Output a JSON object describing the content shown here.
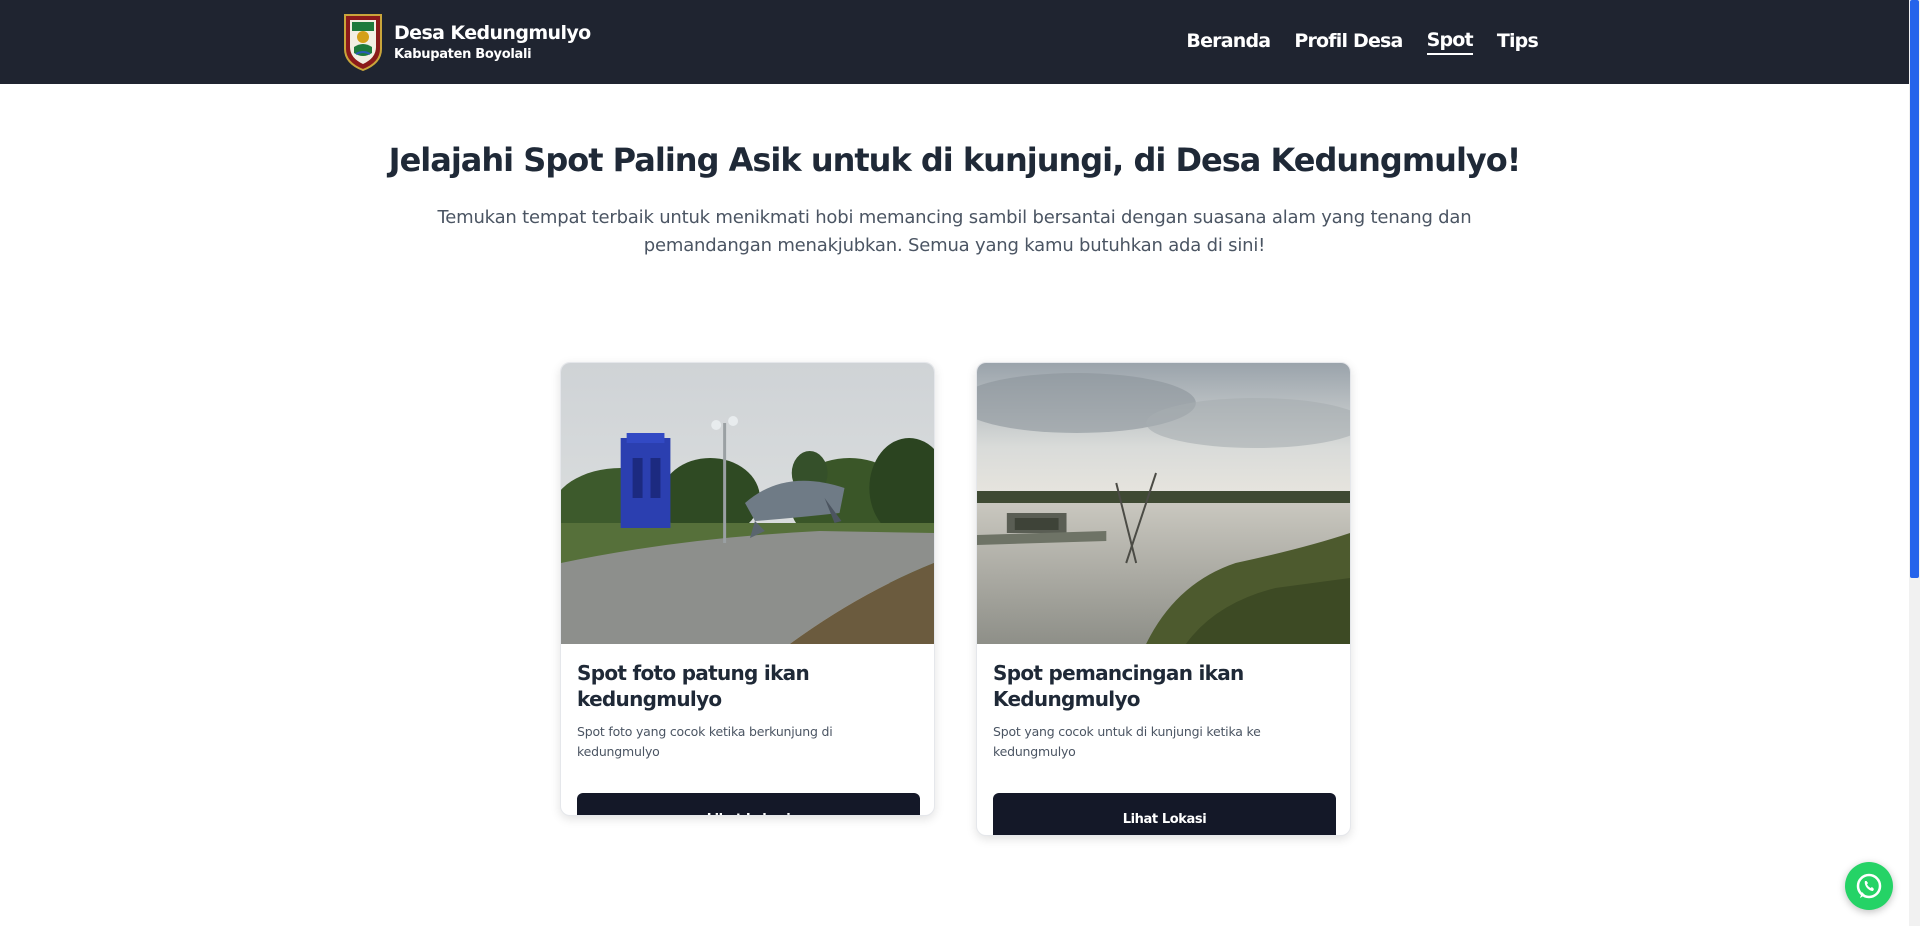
{
  "navbar": {
    "brand_title": "Desa Kedungmulyo",
    "brand_subtitle": "Kabupaten Boyolali",
    "links": [
      {
        "label": "Beranda",
        "active": false
      },
      {
        "label": "Profil Desa",
        "active": false
      },
      {
        "label": "Spot",
        "active": true
      },
      {
        "label": "Tips",
        "active": false
      }
    ]
  },
  "hero": {
    "title": "Jelajahi Spot Paling Asik untuk di kunjungi, di Desa Kedungmulyo!",
    "description": "Temukan tempat terbaik untuk menikmati hobi memancing sambil bersantai dengan suasana alam yang tenang dan pemandangan menakjubkan. Semua yang kamu butuhkan ada di sini!"
  },
  "cards": [
    {
      "title": "Spot foto patung ikan kedungmulyo",
      "description": "Spot foto yang cocok ketika berkunjung di kedungmulyo",
      "button_label": "Lihat Lokasi"
    },
    {
      "title": "Spot pemancingan ikan Kedungmulyo",
      "description": "Spot yang cocok untuk di kunjungi ketika ke kedungmulyo",
      "button_label": "Lihat Lokasi"
    }
  ],
  "colors": {
    "navbar_bg": "#1f2430",
    "button_bg": "#141828",
    "scroll_thumb": "#2563eb",
    "whatsapp": "#25d366"
  },
  "icons": {
    "brand": "village-crest-icon",
    "floating": "whatsapp-icon"
  }
}
